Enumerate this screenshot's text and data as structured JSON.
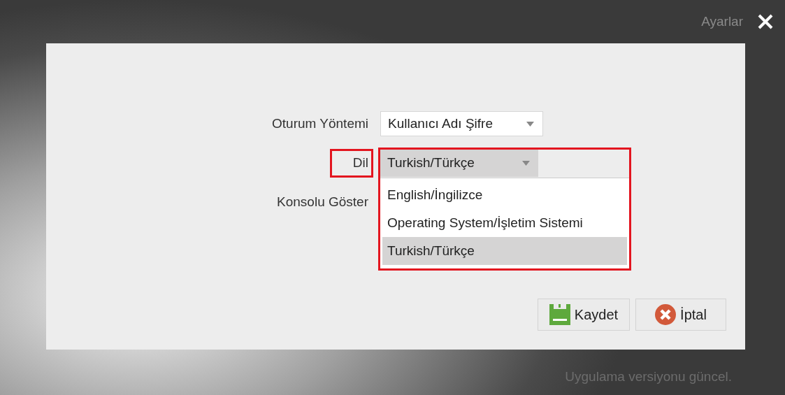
{
  "window": {
    "title": "Ayarlar"
  },
  "form": [
    {
      "kind": "select",
      "label": "Oturum Yöntemi",
      "value": "Kullanıcı Adı Şifre",
      "open": false,
      "highlighted": false
    },
    {
      "kind": "select",
      "label": "Dil",
      "value": "Turkish/Türkçe",
      "open": true,
      "highlighted": true,
      "options": [
        {
          "label": "English/İngilizce",
          "selected": false
        },
        {
          "label": "Operating System/İşletim Sistemi",
          "selected": false
        },
        {
          "label": "Turkish/Türkçe",
          "selected": true
        }
      ]
    },
    {
      "kind": "hidden",
      "label": "Konsolu Göster",
      "highlighted": false
    }
  ],
  "buttons": [
    {
      "kind": "save",
      "label": "Kaydet"
    },
    {
      "kind": "cancel",
      "label": "İptal"
    }
  ],
  "status": "Uygulama versiyonu güncel."
}
